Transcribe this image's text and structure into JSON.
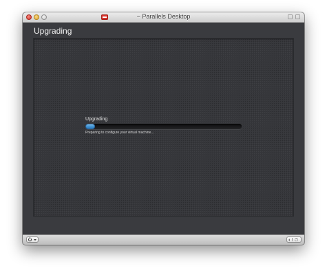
{
  "window": {
    "title": "~ Parallels Desktop"
  },
  "header": {
    "title": "Upgrading"
  },
  "progress": {
    "label": "Upgrading",
    "status": "Preparing to configure your virtual machine...",
    "fraction": 0.06
  },
  "colors": {
    "accent": "#3c8fd0",
    "background": "#3a3b3f",
    "panel": "#36373b"
  },
  "icons": {
    "close": "close-icon",
    "minimize": "minimize-icon",
    "zoom": "zoom-icon",
    "app": "parallels-icon",
    "power": "power-icon",
    "chevron": "chevron-down-icon",
    "back": "back-icon",
    "gear": "gear-icon"
  }
}
